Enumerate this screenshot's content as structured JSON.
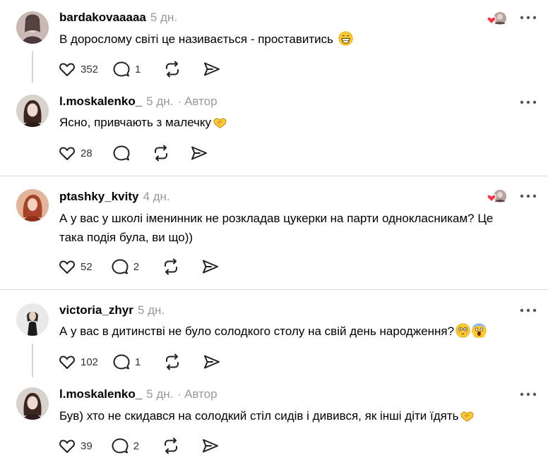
{
  "comments": [
    {
      "username": "bardakovaaaaa",
      "time": "5 дн.",
      "text": "В дорослому світі це називається - проставитись",
      "likes": "352",
      "replies": "1"
    },
    {
      "username": "l.moskalenko_",
      "time": "5 дн.",
      "separator": "·",
      "author_label": "Автор",
      "text": "Ясно, привчають з малечку",
      "likes": "28"
    },
    {
      "username": "ptashky_kvity",
      "time": "4 дн.",
      "text_line1": "А у вас у школі іменинник не розкладав цукерки на парти однокласникам? Це",
      "text_line2": "така подія була, ви що))",
      "likes": "52",
      "replies": "2"
    },
    {
      "username": "victoria_zhyr",
      "time": "5 дн.",
      "text": "А у вас в дитинстві не було солодкого столу на свій день народження?",
      "likes": "102",
      "replies": "1"
    },
    {
      "username": "l.moskalenko_",
      "time": "5 дн.",
      "separator": "·",
      "author_label": "Автор",
      "text": "Був) хто не скидався на солодкий стіл сидів і дивився, як інші діти їдять",
      "likes": "39",
      "replies": "2"
    }
  ],
  "icons": {
    "like": "heart-outline-icon",
    "reply": "comment-bubble-icon",
    "repost": "repost-arrows-icon",
    "share": "paper-plane-icon",
    "more": "more-dots-icon",
    "liked_by_author": "heart-with-avatar-icon"
  },
  "colors": {
    "liked_heart": "#ff3040",
    "muted_text": "#999999",
    "divider": "#dcdcdc"
  }
}
